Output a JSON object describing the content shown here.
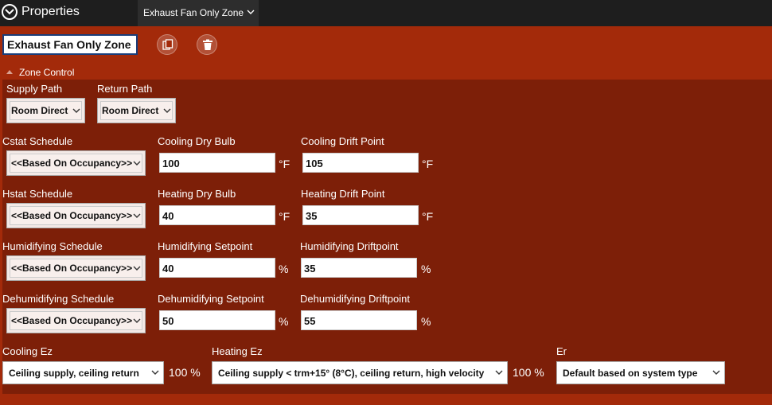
{
  "header": {
    "title": "Properties",
    "tab_label": "Exhaust Fan Only Zone"
  },
  "toolbar": {
    "name_value": "Exhaust Fan Only Zone",
    "copy_icon": "copy-icon",
    "delete_icon": "trash-icon"
  },
  "section": {
    "title": "Zone Control"
  },
  "supply_path": {
    "label": "Supply Path",
    "value": "Room Direct"
  },
  "return_path": {
    "label": "Return Path",
    "value": "Room Direct"
  },
  "cstat": {
    "schedule_label": "Cstat Schedule",
    "schedule_value": "<<Based On Occupancy>>",
    "setpoint_label": "Cooling Dry Bulb",
    "setpoint_value": "100",
    "setpoint_unit": "°F",
    "drift_label": "Cooling Drift Point",
    "drift_value": "105",
    "drift_unit": "°F"
  },
  "hstat": {
    "schedule_label": "Hstat Schedule",
    "schedule_value": "<<Based On Occupancy>>",
    "setpoint_label": "Heating Dry Bulb",
    "setpoint_value": "40",
    "setpoint_unit": "°F",
    "drift_label": "Heating Drift Point",
    "drift_value": "35",
    "drift_unit": "°F"
  },
  "humid": {
    "schedule_label": "Humidifying Schedule",
    "schedule_value": "<<Based On Occupancy>>",
    "setpoint_label": "Humidifying Setpoint",
    "setpoint_value": "40",
    "setpoint_unit": "%",
    "drift_label": "Humidifying Driftpoint",
    "drift_value": "35",
    "drift_unit": "%"
  },
  "dehumid": {
    "schedule_label": "Dehumidifying Schedule",
    "schedule_value": "<<Based On Occupancy>>",
    "setpoint_label": "Dehumidifying Setpoint",
    "setpoint_value": "50",
    "setpoint_unit": "%",
    "drift_label": "Dehumidifying Driftpoint",
    "drift_value": "55",
    "drift_unit": "%"
  },
  "cooling_ez": {
    "label": "Cooling Ez",
    "value": "Ceiling supply, ceiling return",
    "percent": "100 %"
  },
  "heating_ez": {
    "label": "Heating Ez",
    "value": "Ceiling supply < trm+15° (8°C), ceiling return, high velocity",
    "percent": "100 %"
  },
  "er": {
    "label": "Er",
    "value": "Default based on system type"
  },
  "colors": {
    "background": "#a32a0a",
    "panel": "#7d1f08",
    "topbar": "#1e1e1e"
  }
}
